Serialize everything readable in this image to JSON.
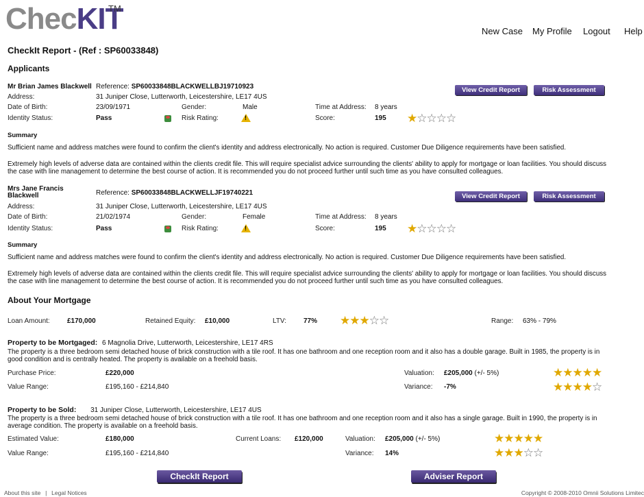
{
  "brand": {
    "logo_part1": "Chec",
    "logo_part2": "KIT",
    "tm": "TM"
  },
  "nav": {
    "new_case": "New Case",
    "my_profile": "My Profile",
    "logout": "Logout",
    "help": "Help"
  },
  "report": {
    "title": "CheckIt Report -   (Ref : SP60033848)"
  },
  "applicants_heading": "Applicants",
  "applicants": [
    {
      "name": "Mr Brian James Blackwell",
      "reference_label": "Reference:",
      "reference": "SP60033848BLACKWELLBJ19710923",
      "address_label": "Address:",
      "address": "31 Juniper Close, Lutterworth, Leicestershire, LE17 4US",
      "dob_label": "Date of Birth:",
      "dob": "23/09/1971",
      "gender_label": "Gender:",
      "gender": "Male",
      "time_label": "Time at Address:",
      "time": "8 years",
      "identity_label": "Identity Status:",
      "identity": "Pass",
      "risk_label": "Risk Rating:",
      "score_label": "Score:",
      "score": "195",
      "score_stars": 1,
      "summary_heading": "Summary",
      "summary1": "Sufficient name and address matches were found to confirm the client's identity and address electronically. No action is required. Customer Due Diligence requirements have been satisfied.",
      "summary2": "Extremely high levels of adverse data are contained within the clients credit file. This will require specialist advice surrounding the clients' ability to apply for mortgage or loan facilities. You should discuss the case with line management to determine the best course of action. It is recommended you do not proceed further until such time as you have consulted colleagues.",
      "btn_credit": "View Credit Report",
      "btn_risk": "Risk Assessment"
    },
    {
      "name": "Mrs Jane Francis Blackwell",
      "reference_label": "Reference:",
      "reference": "SP60033848BLACKWELLJF19740221",
      "address_label": "Address:",
      "address": "31 Juniper Close, Lutterworth, Leicestershire, LE17 4US",
      "dob_label": "Date of Birth:",
      "dob": "21/02/1974",
      "gender_label": "Gender:",
      "gender": "Female",
      "time_label": "Time at Address:",
      "time": "8 years",
      "identity_label": "Identity Status:",
      "identity": "Pass",
      "risk_label": "Risk Rating:",
      "score_label": "Score:",
      "score": "195",
      "score_stars": 1,
      "summary_heading": "Summary",
      "summary1": "Sufficient name and address matches were found to confirm the client's identity and address electronically. No action is required. Customer Due Diligence requirements have been satisfied.",
      "summary2": "Extremely high levels of adverse data are contained within the clients credit file. This will require specialist advice surrounding the clients' ability to apply for mortgage or loan facilities. You should discuss the case with line management to determine the best course of action. It is recommended you do not proceed further until such time as you have consulted colleagues.",
      "btn_credit": "View Credit Report",
      "btn_risk": "Risk Assessment"
    }
  ],
  "mortgage": {
    "heading": "About Your Mortgage",
    "loan_label": "Loan Amount:",
    "loan": "£170,000",
    "equity_label": "Retained Equity:",
    "equity": "£10,000",
    "ltv_label": "LTV:",
    "ltv": "77%",
    "ltv_stars": 3,
    "range_label": "Range:",
    "range": "63% - 79%"
  },
  "property_mortgaged": {
    "heading": "Property to be Mortgaged:",
    "address": "6 Magnolia Drive, Lutterworth, Leicestershire, LE17 4RS",
    "description": "The property is a three bedroom semi detached house of brick construction with a tile roof. It has one bathroom and one reception room and it also has a double garage. Built in 1985, the property is in good condition and is centrally heated. The property is available on a freehold basis.",
    "purchase_label": "Purchase Price:",
    "purchase": "£220,000",
    "value_range_label": "Value Range:",
    "value_range": "£195,160 - £214,840",
    "valuation_label": "Valuation:",
    "valuation": "£205,000",
    "valuation_note": "(+/- 5%)",
    "valuation_stars": 5,
    "variance_label": "Variance:",
    "variance": "-7%",
    "variance_stars": 4
  },
  "property_sold": {
    "heading": "Property to be Sold:",
    "address": "31 Juniper Close, Lutterworth, Leicestershire, LE17 4US",
    "description": "The property is a three bedroom semi detached house of brick construction with a tile roof. It has one bathroom and one reception room and it also has a single garage. Built in 1990, the property is in average condition. The property is available on a freehold basis.",
    "estimated_label": "Estimated Value:",
    "estimated": "£180,000",
    "loans_label": "Current Loans:",
    "loans": "£120,000",
    "value_range_label": "Value Range:",
    "value_range": "£195,160 - £214,840",
    "valuation_label": "Valuation:",
    "valuation": "£205,000",
    "valuation_note": "(+/- 5%)",
    "valuation_stars": 5,
    "variance_label": "Variance:",
    "variance": "14%",
    "variance_stars": 3
  },
  "buttons": {
    "checkit_report": "CheckIt Report",
    "adviser_report": "Adviser Report"
  },
  "footer": {
    "about": "About this site",
    "sep": "|",
    "legal": "Legal Notices",
    "copyright": "Copyright © 2008-2010 Omnii Solutions Limitec"
  },
  "colors": {
    "brand_purple": "#4a3d86",
    "star_gold": "#e0a800",
    "warn_yellow": "#e6b300"
  }
}
